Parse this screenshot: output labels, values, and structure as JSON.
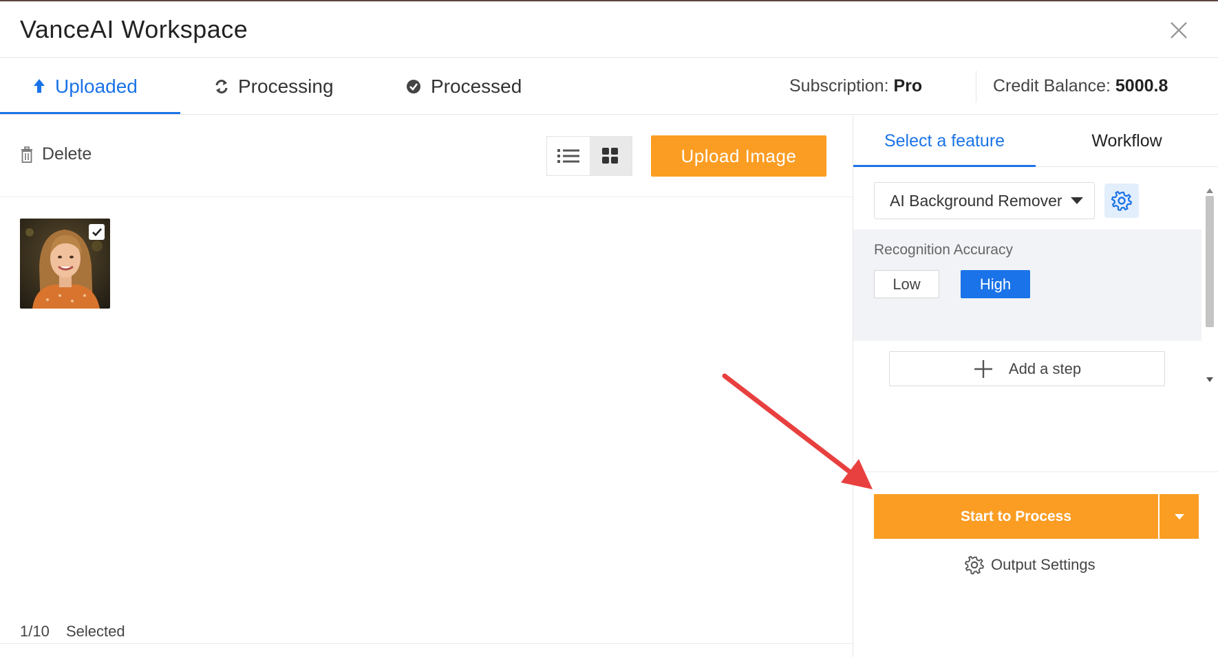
{
  "app": {
    "title": "VanceAI Workspace"
  },
  "tabs": [
    {
      "label": "Uploaded",
      "icon": "upload-arrow-icon",
      "active": true
    },
    {
      "label": "Processing",
      "icon": "refresh-icon",
      "active": false
    },
    {
      "label": "Processed",
      "icon": "check-circle-icon",
      "active": false
    }
  ],
  "account": {
    "subscription_label": "Subscription:",
    "subscription_value": "Pro",
    "credit_label": "Credit Balance:",
    "credit_value": "5000.8"
  },
  "toolbar": {
    "delete_label": "Delete",
    "view_modes": [
      "list",
      "grid"
    ],
    "active_view": "grid",
    "upload_label": "Upload Image"
  },
  "images": [
    {
      "selected": true,
      "description_icon": "portrait-thumbnail"
    }
  ],
  "selection": {
    "count": "1/10",
    "label": "Selected"
  },
  "side_panel": {
    "tabs": [
      {
        "label": "Select a feature",
        "active": true
      },
      {
        "label": "Workflow",
        "active": false
      }
    ],
    "feature": {
      "selected": "AI Background Remover"
    },
    "accuracy": {
      "label": "Recognition Accuracy",
      "options": [
        "Low",
        "High"
      ],
      "selected": "High"
    },
    "add_step_label": "Add a step",
    "process_label": "Start to Process",
    "output_settings_label": "Output Settings"
  },
  "colors": {
    "accent_blue": "#1a73e8",
    "accent_orange": "#fb9d23",
    "annotation_red": "#e8403f"
  }
}
